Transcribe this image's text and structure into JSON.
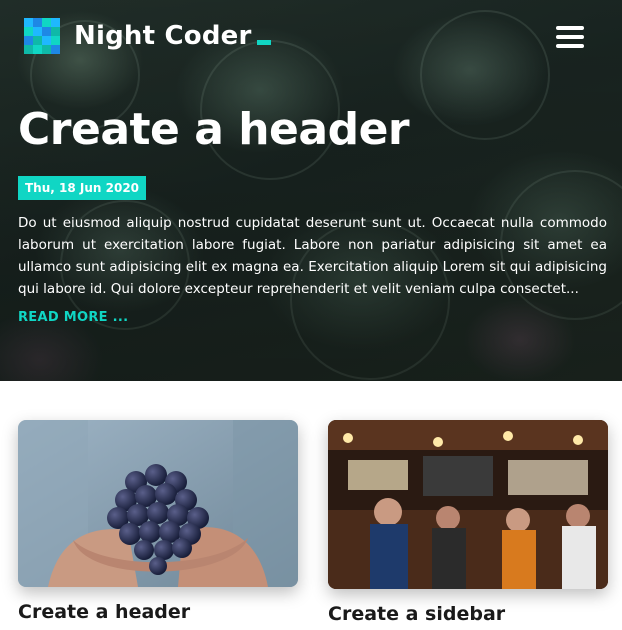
{
  "brand": {
    "name": "Night Coder",
    "accent_color": "#10d6c4",
    "logo_colors": [
      "#1fb8ff",
      "#10d6c4",
      "#1e88e5",
      "#0fb9a8"
    ]
  },
  "nav": {
    "menu_icon": "hamburger-menu-icon"
  },
  "hero": {
    "title": "Create a header",
    "date": "Thu, 18 Jun 2020",
    "excerpt": "Do ut eiusmod aliquip nostrud cupidatat deserunt sunt ut. Occaecat nulla commodo laborum ut exercitation labore fugiat. Labore non pariatur adipisicing sit amet ea ullamco sunt adipisicing elit ex magna ea. Exercitation aliquip Lorem sit qui adipisicing qui labore id. Qui dolore excepteur reprehenderit et velit veniam culpa consectet...",
    "read_more": "READ MORE ..."
  },
  "posts": [
    {
      "title": "Create a header",
      "image": "grapes-in-hands-photo"
    },
    {
      "title": "Create a sidebar",
      "image": "crowded-bar-interior-photo"
    }
  ]
}
